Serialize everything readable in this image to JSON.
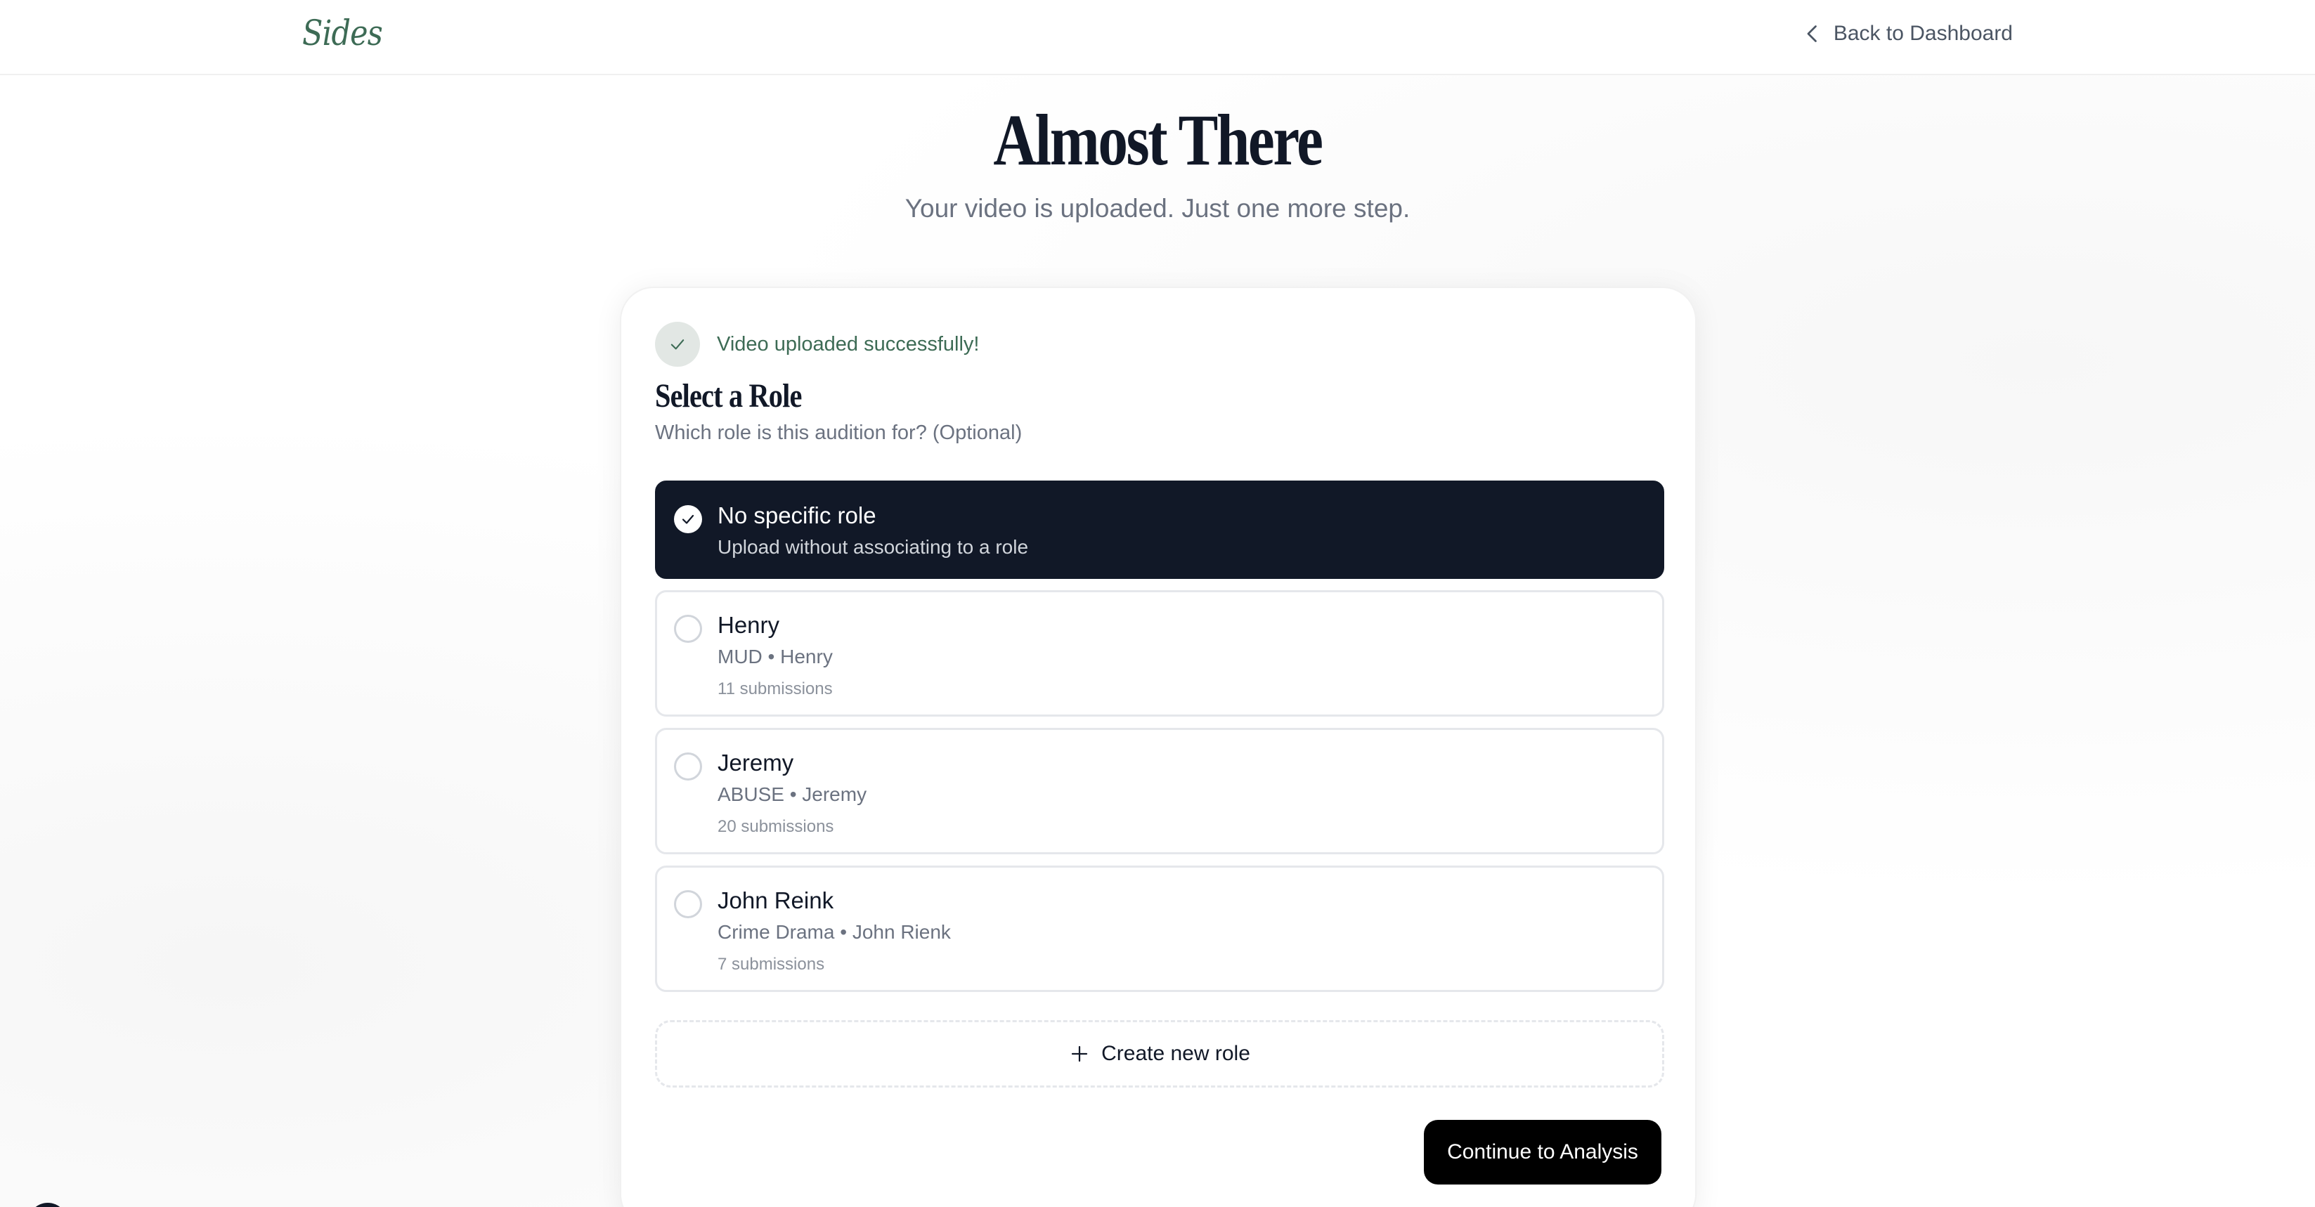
{
  "header": {
    "logo": "Sides",
    "back_label": "Back to Dashboard",
    "back_icon": "chevron-left-icon"
  },
  "hero": {
    "title": "Almost There",
    "subtitle": "Your video is uploaded. Just one more step."
  },
  "card": {
    "success_icon": "check-icon",
    "success_text": "Video uploaded successfully!",
    "section_title": "Select a Role",
    "section_subtitle": "Which role is this audition for? (Optional)",
    "roles": [
      {
        "name": "No specific role",
        "meta": "Upload without associating to a role",
        "count": "",
        "selected": true
      },
      {
        "name": "Henry",
        "meta": "MUD • Henry",
        "count": "11 submissions",
        "selected": false
      },
      {
        "name": "Jeremy",
        "meta": "ABUSE • Jeremy",
        "count": "20 submissions",
        "selected": false
      },
      {
        "name": "John Reink",
        "meta": "Crime Drama • John Rienk",
        "count": "7 submissions",
        "selected": false
      }
    ],
    "create_label": "Create new role",
    "create_icon": "plus-icon",
    "continue_label": "Continue to Analysis"
  },
  "colors": {
    "brand_green": "#3d6b55",
    "selected_bg": "#111827",
    "primary_button": "#000000"
  }
}
